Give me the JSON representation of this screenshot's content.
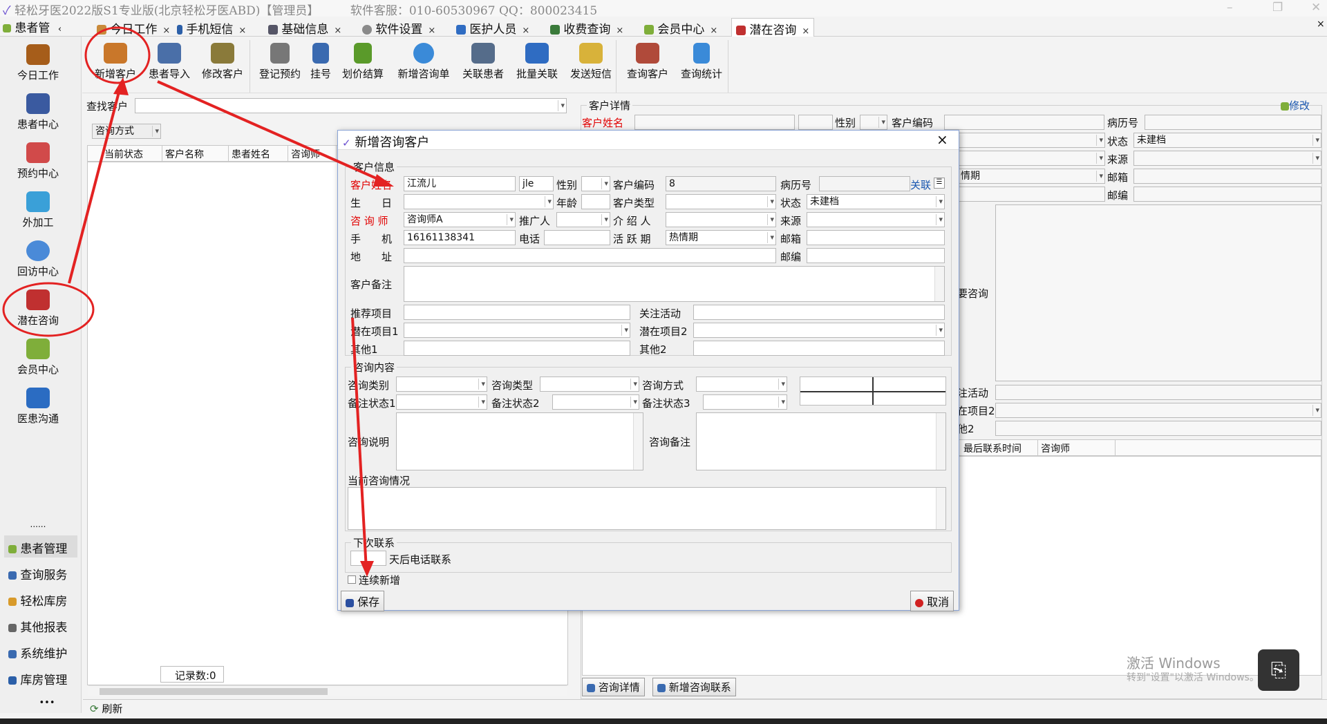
{
  "app": {
    "title": "轻松牙医2022版S1专业版(北京轻松牙医ABD)【管理员】",
    "service": "软件客服：010-60530967 QQ：800023415"
  },
  "sidebar_head": "患者管",
  "tabs": [
    {
      "label": "今日工作"
    },
    {
      "label": "手机短信"
    },
    {
      "label": "基础信息"
    },
    {
      "label": "软件设置"
    },
    {
      "label": "医护人员"
    },
    {
      "label": "收费查询"
    },
    {
      "label": "会员中心"
    },
    {
      "label": "潜在咨询"
    }
  ],
  "tab_close": "×",
  "sidebar": {
    "items": [
      "今日工作",
      "患者中心",
      "预约中心",
      "外加工",
      "回访中心",
      "潜在咨询",
      "会员中心",
      "医患沟通"
    ],
    "ellipsis": "......",
    "bottom": [
      "患者管理",
      "查询服务",
      "轻松库房",
      "其他报表",
      "系统维护",
      "库房管理"
    ],
    "more": "•••"
  },
  "toolbar": {
    "g1": [
      "新增客户",
      "患者导入",
      "修改客户"
    ],
    "g2": [
      "登记预约",
      "挂号",
      "划价结算",
      "新增咨询单",
      "关联患者",
      "批量关联",
      "发送短信"
    ],
    "g3": [
      "查询客户",
      "查询统计"
    ]
  },
  "left": {
    "search_label": "查找客户",
    "filter": "咨询方式",
    "columns": [
      "当前状态",
      "客户名称",
      "患者姓名",
      "咨询师"
    ],
    "records": "记录数:0",
    "refresh": "刷新"
  },
  "right": {
    "group": "客户详情",
    "modify": "修改",
    "name_label": "客户姓名",
    "gender": "性别",
    "code": "客户编码",
    "record_no": "病历号",
    "status": "状态",
    "status_val": "未建档",
    "source": "来源",
    "email": "邮箱",
    "zip": "邮编",
    "active_val": "情期",
    "consult": "要咨询",
    "attention": "注活动",
    "potential2": "在项目2",
    "other2": "他2",
    "col_last": "最后联系时间",
    "col_consultant": "咨询师",
    "bottom_tabs": [
      "咨询详情",
      "新增咨询联系"
    ]
  },
  "dialog": {
    "title": "新增咨询客户",
    "close": "×",
    "info_group": "客户信息",
    "name_label": "客户姓名",
    "name_val": "江流儿",
    "pinyin_val": "jle",
    "gender": "性别",
    "code_label": "客户编码",
    "code_val": "8",
    "record_label": "病历号",
    "link": "关联",
    "birth": "生　　日",
    "age": "年龄",
    "ctype": "客户类型",
    "status": "状态",
    "status_val": "未建档",
    "consultant": "咨 询 师",
    "consultant_val": "咨询师A",
    "promoter": "推广人",
    "referrer": "介 绍 人",
    "source": "来源",
    "mobile": "手　　机",
    "mobile_val": "16161138341",
    "phone": "电话",
    "active": "活 跃 期",
    "active_val": "热情期",
    "email": "邮箱",
    "address": "地　　址",
    "zip": "邮编",
    "remark": "客户备注",
    "recommend": "推荐项目",
    "attention": "关注活动",
    "potential1": "潜在项目1",
    "potential2": "潜在项目2",
    "other1": "其他1",
    "other2": "其他2",
    "content_group": "咨询内容",
    "ccat": "咨询类别",
    "cctype": "咨询类型",
    "cway": "咨询方式",
    "rs1": "备注状态1",
    "rs2": "备注状态2",
    "rs3": "备注状态3",
    "cdesc": "咨询说明",
    "cremark": "咨询备注",
    "current": "当前咨询情况",
    "next_group": "下次联系",
    "next_text": "天后电话联系",
    "continuous": "连续新增",
    "save": "保存",
    "cancel": "取消"
  },
  "watermark": {
    "line1": "激活 Windows",
    "line2": "转到\"设置\"以激活 Windows。"
  },
  "colors": {
    "accent": "#e32222",
    "link": "#0645ad",
    "dialog_bg": "#f0f0f0",
    "sidebar_bg": "#efefef"
  }
}
